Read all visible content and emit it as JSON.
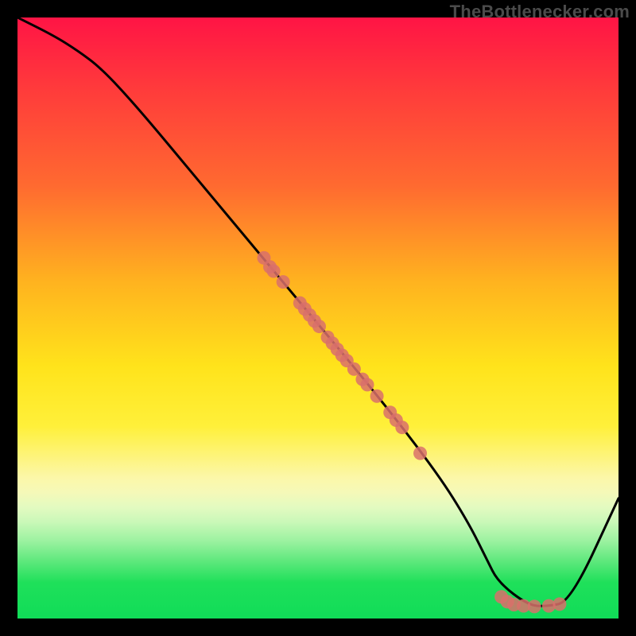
{
  "watermark": "TheBottlenecker.com",
  "chart_data": {
    "type": "line",
    "title": "",
    "xlabel": "",
    "ylabel": "",
    "xlim": [
      0,
      100
    ],
    "ylim": [
      0,
      100
    ],
    "curve": {
      "name": "bottleneck-curve",
      "x": [
        0,
        6,
        10,
        14,
        20,
        30,
        40,
        50,
        60,
        70,
        75,
        78,
        80,
        85,
        88,
        92,
        100
      ],
      "y": [
        100,
        97,
        94.5,
        91.5,
        85,
        73,
        61,
        49,
        37,
        24,
        16,
        10,
        6,
        2.2,
        2.0,
        2.8,
        20
      ]
    },
    "series": [
      {
        "name": "mid-descent-cluster",
        "type": "scatter",
        "points": [
          {
            "x": 41.0,
            "y": 60.0
          },
          {
            "x": 42.0,
            "y": 58.5
          },
          {
            "x": 42.6,
            "y": 57.8
          },
          {
            "x": 44.2,
            "y": 56.0
          },
          {
            "x": 47.0,
            "y": 52.5
          },
          {
            "x": 47.8,
            "y": 51.5
          },
          {
            "x": 48.6,
            "y": 50.5
          },
          {
            "x": 49.4,
            "y": 49.5
          },
          {
            "x": 50.2,
            "y": 48.6
          },
          {
            "x": 51.6,
            "y": 46.8
          },
          {
            "x": 52.4,
            "y": 45.8
          },
          {
            "x": 53.2,
            "y": 44.8
          },
          {
            "x": 54.0,
            "y": 43.8
          },
          {
            "x": 54.8,
            "y": 42.9
          },
          {
            "x": 56.0,
            "y": 41.5
          },
          {
            "x": 57.4,
            "y": 39.8
          },
          {
            "x": 58.2,
            "y": 38.9
          },
          {
            "x": 59.8,
            "y": 37.0
          },
          {
            "x": 62.0,
            "y": 34.3
          },
          {
            "x": 63.0,
            "y": 33.0
          },
          {
            "x": 64.0,
            "y": 31.8
          },
          {
            "x": 67.0,
            "y": 27.5
          }
        ]
      },
      {
        "name": "valley-cluster",
        "type": "scatter",
        "points": [
          {
            "x": 80.5,
            "y": 3.6
          },
          {
            "x": 81.5,
            "y": 2.8
          },
          {
            "x": 82.6,
            "y": 2.3
          },
          {
            "x": 84.2,
            "y": 2.1
          },
          {
            "x": 86.0,
            "y": 2.0
          },
          {
            "x": 88.4,
            "y": 2.1
          },
          {
            "x": 90.2,
            "y": 2.4
          }
        ]
      }
    ],
    "colors": {
      "curve": "#000000",
      "marker": "#d9706b"
    }
  }
}
